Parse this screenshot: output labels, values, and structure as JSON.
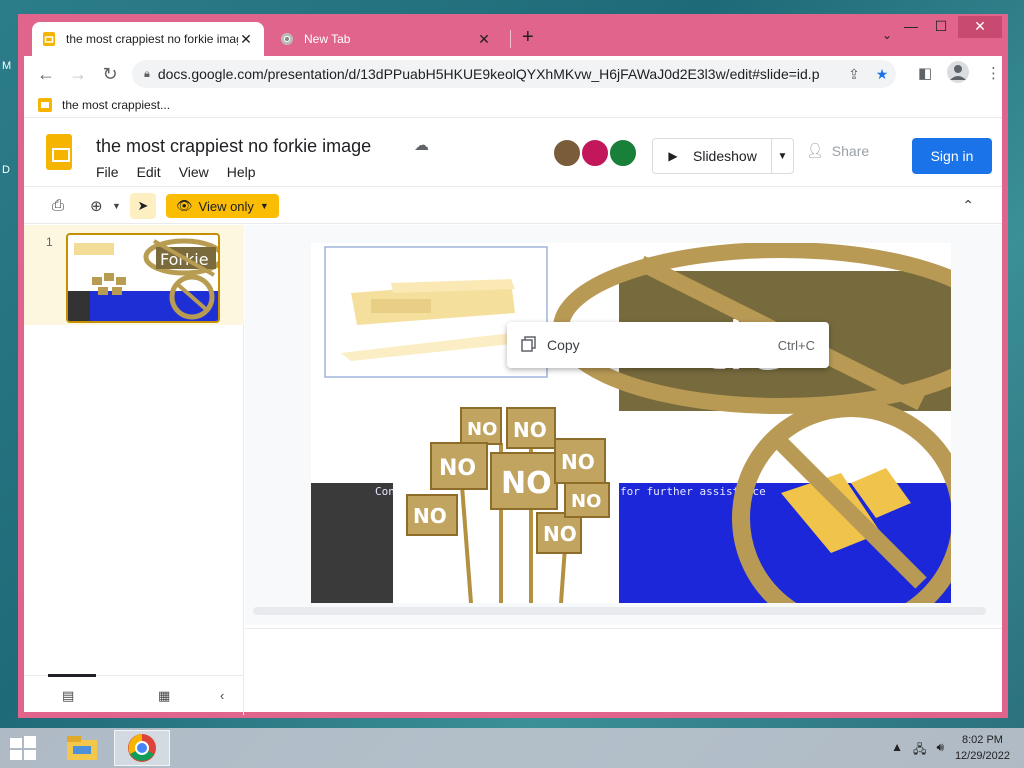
{
  "desktop": {
    "label_m": "M",
    "label_d": "D"
  },
  "browser": {
    "tabs": [
      {
        "title": "the most crappiest no forkie image",
        "favicon": "slides-icon"
      },
      {
        "title": "New Tab",
        "favicon": "chrome-icon"
      }
    ],
    "new_tab_symbol": "+",
    "address": "docs.google.com/presentation/d/13dPPuabH5HKUE9keolQYXhMKvw_H6jFAWaJ0d2E3l3w/edit#slide=id.p",
    "bookmark": "the most crappiest..."
  },
  "app": {
    "title": "the most crappiest no forkie image",
    "menu": [
      "File",
      "Edit",
      "View",
      "Help"
    ],
    "slideshow_label": "Slideshow",
    "share_label": "Share",
    "signin_label": "Sign in",
    "view_only_label": "View only",
    "slide_number": "1",
    "accent": "#1a73e8",
    "brand": "#f4b400"
  },
  "slide": {
    "forkie_text": "Forkie",
    "big_text": "tie",
    "bsod_text": "Contact your technical support group for further assistance",
    "sign_text": "NO"
  },
  "context_menu": {
    "item_label": "Copy",
    "shortcut": "Ctrl+C"
  },
  "taskbar": {
    "time": "8:02 PM",
    "date": "12/29/2022"
  }
}
